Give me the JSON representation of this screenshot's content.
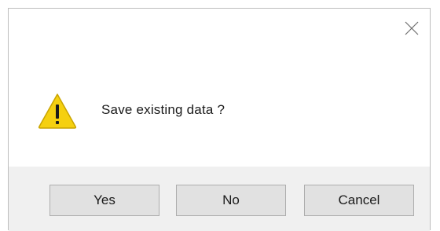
{
  "dialog": {
    "message": "Save existing data ?",
    "icon": "warning-icon",
    "close_icon": "close-icon"
  },
  "buttons": {
    "yes_label": "Yes",
    "no_label": "No",
    "cancel_label": "Cancel"
  },
  "colors": {
    "warning_fill": "#f5d010",
    "warning_stroke": "#c9a400",
    "footer_background": "#f0f0f0",
    "button_background": "#e1e1e1",
    "button_border": "#adadad"
  }
}
